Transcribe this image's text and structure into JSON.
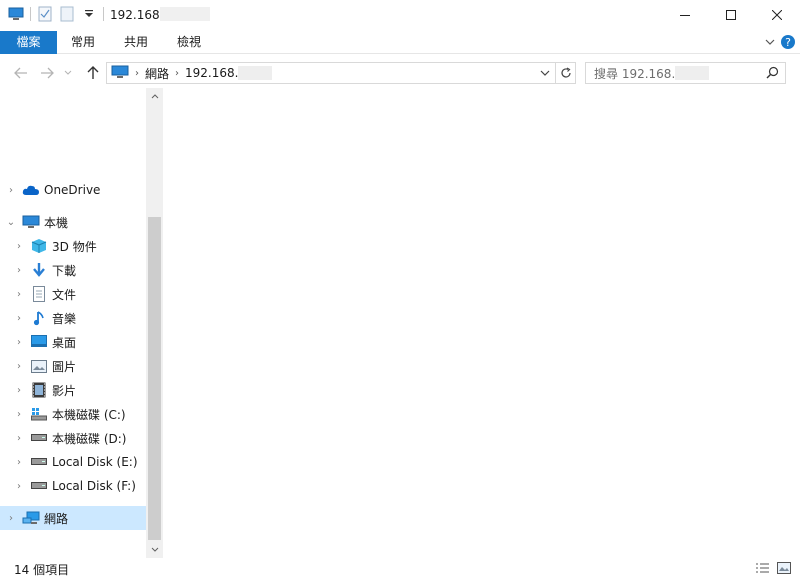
{
  "window": {
    "title_prefix": "192.168",
    "controls": {
      "minimize": "—",
      "maximize": "☐",
      "close": "✕"
    }
  },
  "ribbon": {
    "tabs": [
      "檔案",
      "常用",
      "共用",
      "檢視"
    ]
  },
  "address": {
    "crumb_network": "網路",
    "crumb_ip": "192.168."
  },
  "search": {
    "placeholder": "搜尋 192.168."
  },
  "tree": {
    "items": [
      {
        "label": "OneDrive",
        "icon": "cloud-icon"
      },
      {
        "label": "本機",
        "icon": "computer-icon"
      },
      {
        "label": "3D 物件",
        "icon": "cube-icon"
      },
      {
        "label": "下載",
        "icon": "download-arrow-icon"
      },
      {
        "label": "文件",
        "icon": "document-icon"
      },
      {
        "label": "音樂",
        "icon": "music-note-icon"
      },
      {
        "label": "桌面",
        "icon": "desktop-icon"
      },
      {
        "label": "圖片",
        "icon": "picture-icon"
      },
      {
        "label": "影片",
        "icon": "film-icon"
      },
      {
        "label": "本機磁碟 (C:)",
        "icon": "windows-drive-icon"
      },
      {
        "label": "本機磁碟 (D:)",
        "icon": "drive-icon"
      },
      {
        "label": "Local Disk (E:)",
        "icon": "drive-icon"
      },
      {
        "label": "Local Disk (F:)",
        "icon": "drive-icon"
      },
      {
        "label": "網路",
        "icon": "network-icon"
      }
    ]
  },
  "status": {
    "item_count": "14 個項目"
  },
  "colors": {
    "accent": "#1979ca",
    "selection": "#cce8ff"
  }
}
